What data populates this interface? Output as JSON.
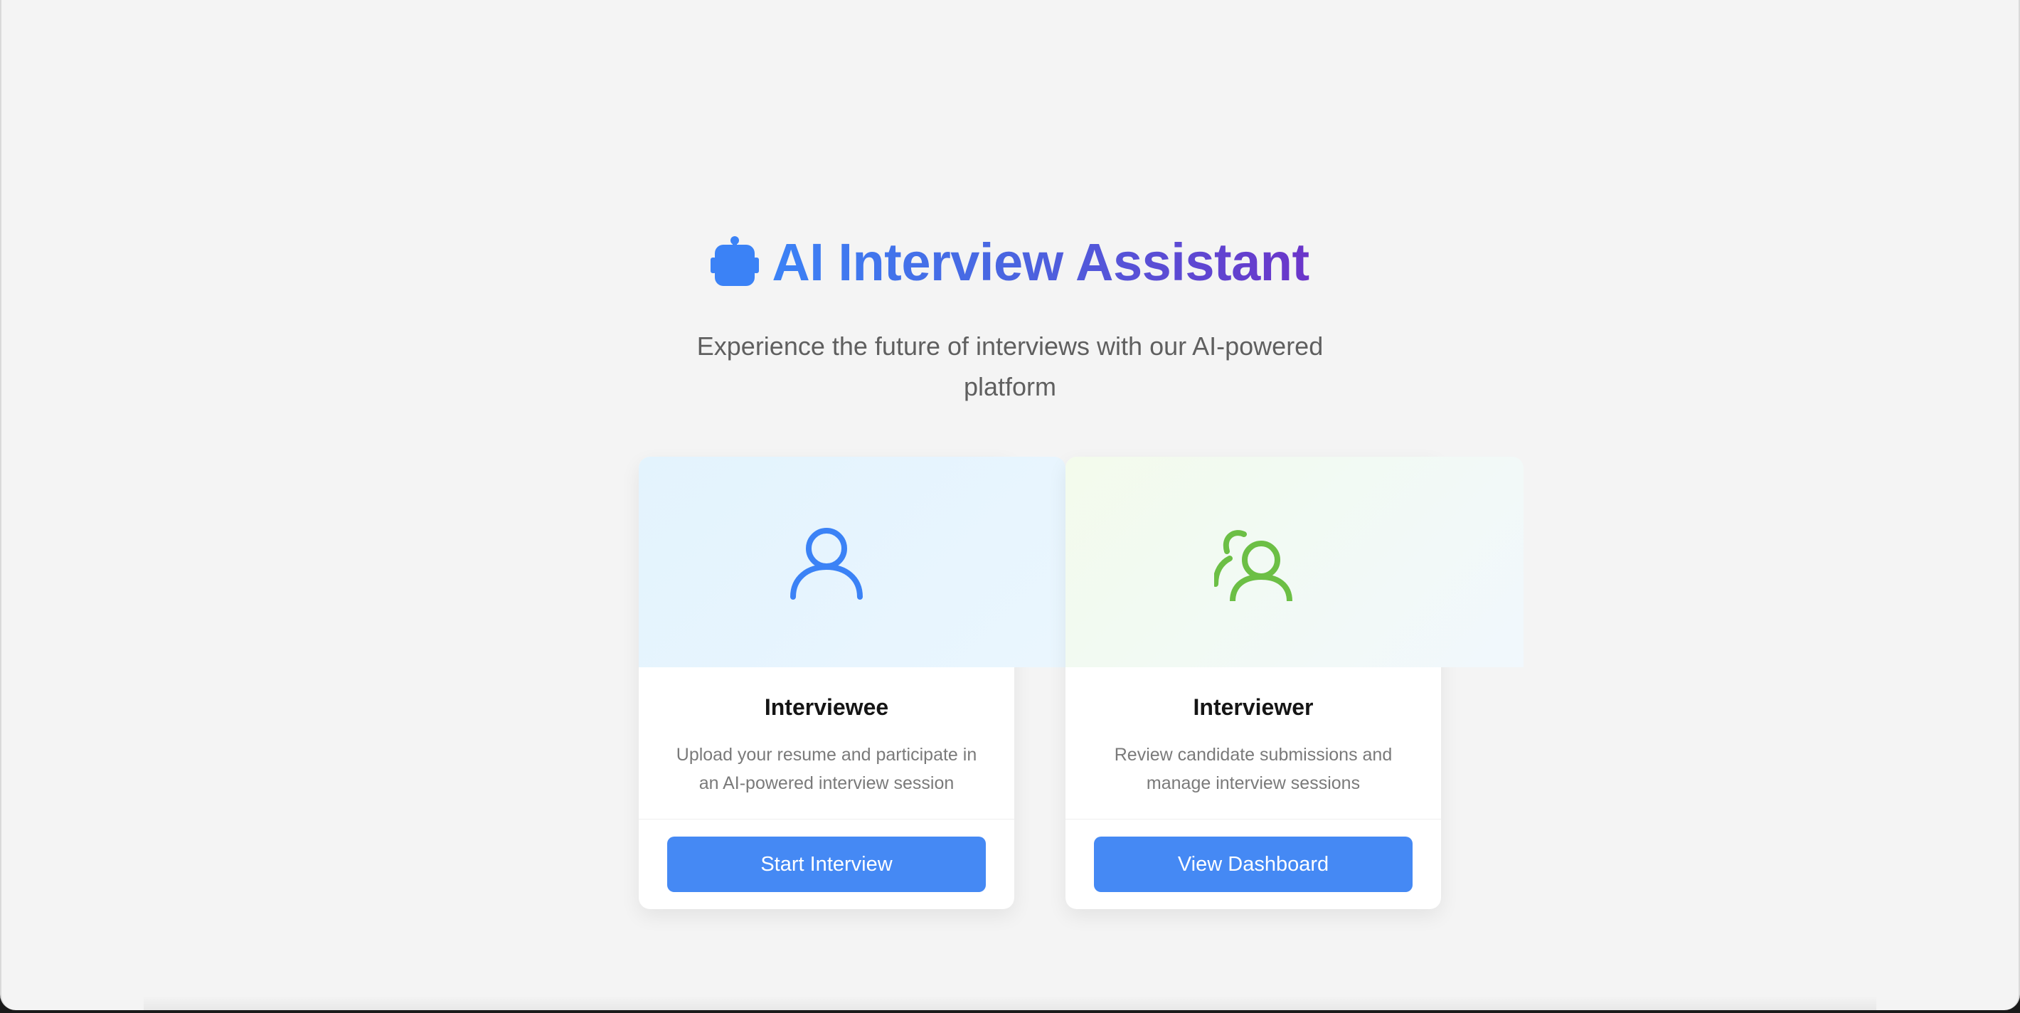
{
  "header": {
    "title": "AI Interview Assistant",
    "title_icon": "robot-icon",
    "subtitle": "Experience the future of interviews with our AI-powered platform"
  },
  "cards": [
    {
      "icon": "user-icon",
      "icon_color": "#3b82f6",
      "title": "Interviewee",
      "description": "Upload your resume and participate in an AI-powered interview session",
      "button_label": "Start Interview"
    },
    {
      "icon": "users-icon",
      "icon_color": "#6cbf45",
      "title": "Interviewer",
      "description": "Review candidate submissions and manage interview sessions",
      "button_label": "View Dashboard"
    }
  ],
  "colors": {
    "background": "#f4f4f4",
    "button": "#4589f4",
    "title_gradient_start": "#3b82f6",
    "title_gradient_end": "#6b35c9"
  }
}
